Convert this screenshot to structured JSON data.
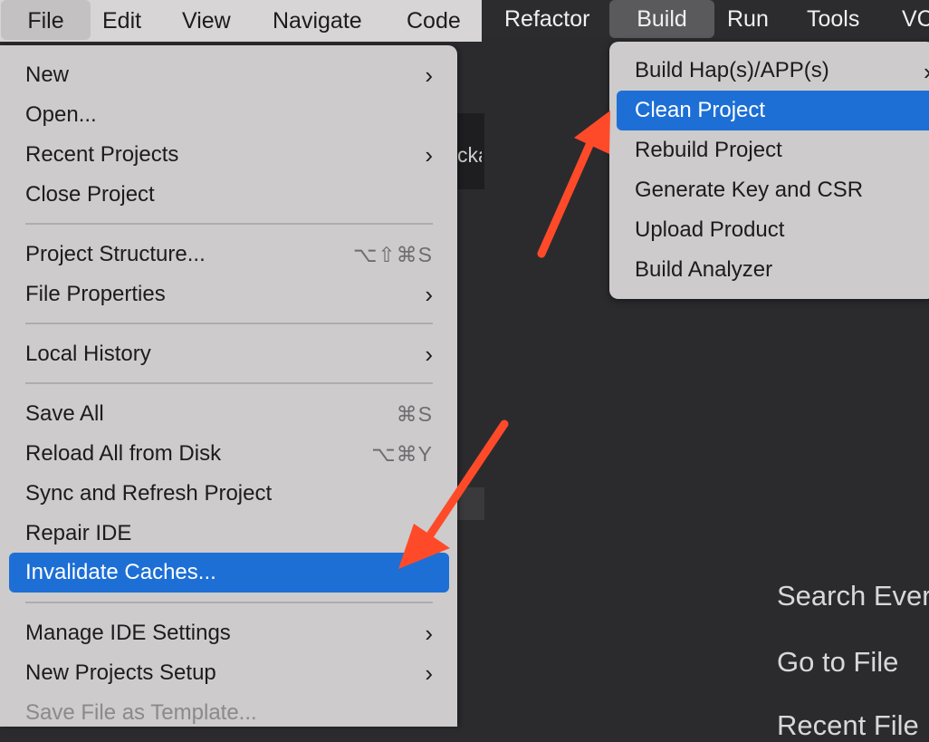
{
  "menubar": {
    "items": [
      "File",
      "Edit",
      "View",
      "Navigate",
      "Code",
      "Refactor",
      "Build",
      "Run",
      "Tools",
      "VC"
    ]
  },
  "ide": {
    "peek_text": "cka",
    "welcome": [
      "Search Ever",
      "Go to File",
      "Recent File"
    ]
  },
  "file_menu": {
    "items": [
      {
        "label": "New",
        "submenu": "›"
      },
      {
        "label": "Open..."
      },
      {
        "label": "Recent Projects",
        "submenu": "›"
      },
      {
        "label": "Close Project"
      },
      {
        "label": "Project Structure...",
        "shortcut": "⌥⇧⌘S"
      },
      {
        "label": "File Properties",
        "submenu": "›"
      },
      {
        "label": "Local History",
        "submenu": "›"
      },
      {
        "label": "Save All",
        "shortcut": "⌘S"
      },
      {
        "label": "Reload All from Disk",
        "shortcut": "⌥⌘Y"
      },
      {
        "label": "Sync and Refresh Project"
      },
      {
        "label": "Repair IDE"
      },
      {
        "label": "Invalidate Caches..."
      },
      {
        "label": "Manage IDE Settings",
        "submenu": "›"
      },
      {
        "label": "New Projects Setup",
        "submenu": "›"
      },
      {
        "label": "Save File as Template..."
      }
    ]
  },
  "build_menu": {
    "items": [
      {
        "label": "Build Hap(s)/APP(s)",
        "submenu": "›"
      },
      {
        "label": "Clean Project"
      },
      {
        "label": "Rebuild Project"
      },
      {
        "label": "Generate Key and CSR"
      },
      {
        "label": "Upload Product"
      },
      {
        "label": "Build Analyzer"
      }
    ]
  },
  "colors": {
    "selection": "#1d6fd6",
    "arrow": "#ff4a2a"
  }
}
